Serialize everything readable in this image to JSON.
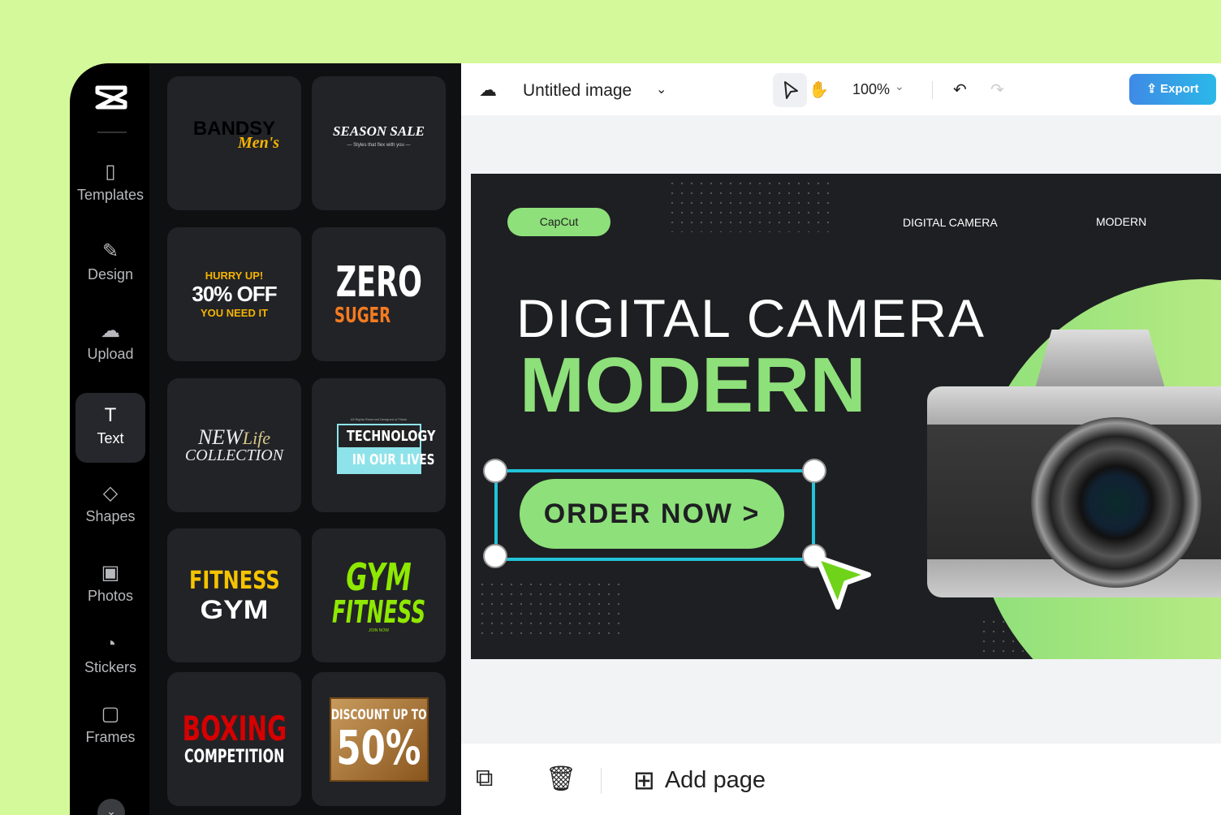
{
  "sidebar": {
    "items": [
      {
        "label": "Templates",
        "icon": "templates-icon",
        "glyph": "▯"
      },
      {
        "label": "Design",
        "icon": "design-icon",
        "glyph": "✎"
      },
      {
        "label": "Upload",
        "icon": "upload-cloud-icon",
        "glyph": "☁"
      },
      {
        "label": "Text",
        "icon": "text-icon",
        "glyph": "T",
        "active": true
      },
      {
        "label": "Shapes",
        "icon": "shapes-icon",
        "glyph": "◇"
      },
      {
        "label": "Photos",
        "icon": "photo-icon",
        "glyph": "▣"
      },
      {
        "label": "Stickers",
        "icon": "sticker-icon",
        "glyph": "◔"
      },
      {
        "label": "Frames",
        "icon": "frame-icon",
        "glyph": "▢"
      }
    ]
  },
  "templates": [
    {
      "l1": "BANDSY",
      "l2": "Men's"
    },
    {
      "l1": "SEASON SALE",
      "l2": "— Styles that flex with you —"
    },
    {
      "l1": "HURRY UP!",
      "l2": "30% OFF",
      "l3": "YOU NEED IT"
    },
    {
      "l1": "ZERO",
      "l2": "SUGER"
    },
    {
      "l1": "NEW",
      "l2": "Life",
      "l3": "COLLECTION"
    },
    {
      "l0": "All Rights Reserved Designed of Tiktok",
      "l1": "TECHNOLOGY",
      "l2": "IN OUR LIVES"
    },
    {
      "l1": "FITNESS",
      "l2": "GYM"
    },
    {
      "l1": "GYM",
      "l2": "FITNESS",
      "l3": "JOIN NOW"
    },
    {
      "l1": "BOXING",
      "l2": "COMPETITION"
    },
    {
      "l1": "DISCOUNT UP TO",
      "l2": "50%"
    }
  ],
  "header": {
    "title": "Untitled image",
    "zoom": "100%",
    "export": "Export"
  },
  "design": {
    "pill": "CapCut",
    "nav1": "DIGITAL CAMERA",
    "nav2": "MODERN",
    "headline": "DIGITAL CAMERA",
    "subhead": "MODERN",
    "cta": "ORDER NOW >",
    "accent": "#8ee07a"
  },
  "footer": {
    "add_page": "Add page"
  }
}
